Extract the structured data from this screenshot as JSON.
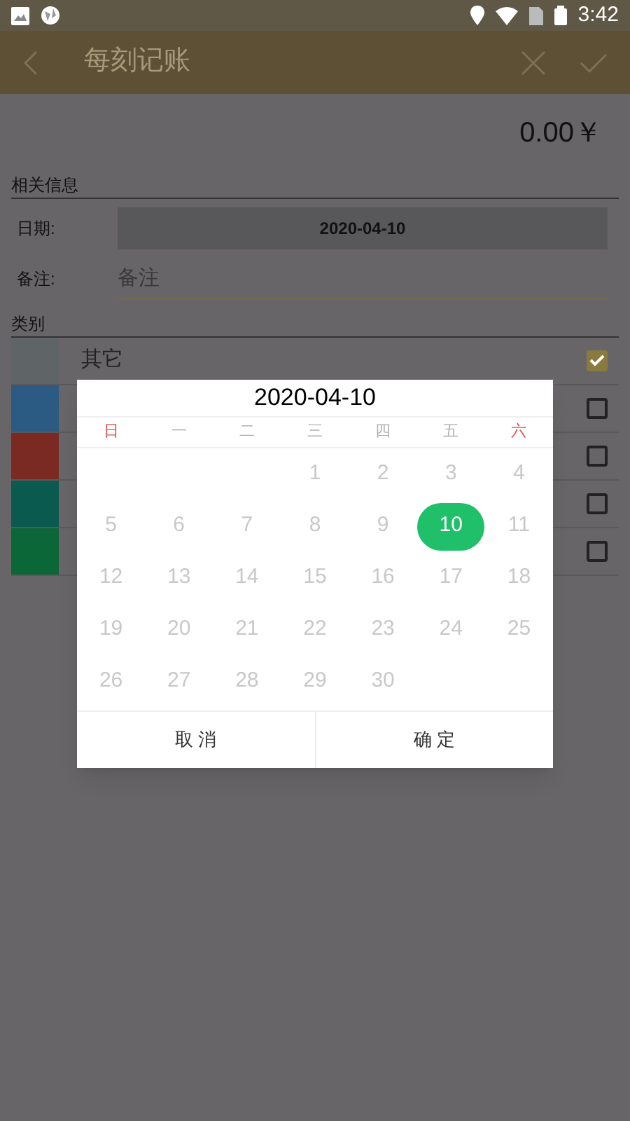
{
  "status_bar": {
    "time": "3:42"
  },
  "header": {
    "title": "每刻记账"
  },
  "amount": "0.00￥",
  "info_section": {
    "title": "相关信息",
    "date_label": "日期:",
    "date_value": "2020-04-10",
    "note_label": "备注:",
    "note_placeholder": "备注"
  },
  "category_section": {
    "title": "类别",
    "items": [
      {
        "name": "其它",
        "color": "#5f6466",
        "checked": true
      },
      {
        "color": "#2b5a82",
        "checked": false
      },
      {
        "color": "#7a2a22",
        "checked": false
      },
      {
        "color": "#0b5a50",
        "checked": false
      },
      {
        "color": "#0b6638",
        "checked": false
      }
    ]
  },
  "dialog": {
    "title": "2020-04-10",
    "weekdays": [
      {
        "label": "日",
        "color": "#d9534f"
      },
      {
        "label": "一",
        "color": "#b0b0b0"
      },
      {
        "label": "二",
        "color": "#b0b0b0"
      },
      {
        "label": "三",
        "color": "#b0b0b0"
      },
      {
        "label": "四",
        "color": "#b0b0b0"
      },
      {
        "label": "五",
        "color": "#b0b0b0"
      },
      {
        "label": "六",
        "color": "#d9534f"
      }
    ],
    "days": [
      {
        "label": "1",
        "selected": false
      },
      {
        "label": "2",
        "selected": false
      },
      {
        "label": "3",
        "selected": false
      },
      {
        "label": "4",
        "selected": false
      },
      {
        "label": "5",
        "selected": false
      },
      {
        "label": "6",
        "selected": false
      },
      {
        "label": "7",
        "selected": false
      },
      {
        "label": "8",
        "selected": false
      },
      {
        "label": "9",
        "selected": false
      },
      {
        "label": "10",
        "selected": true
      },
      {
        "label": "11",
        "selected": false
      },
      {
        "label": "12",
        "selected": false
      },
      {
        "label": "13",
        "selected": false
      },
      {
        "label": "14",
        "selected": false
      },
      {
        "label": "15",
        "selected": false
      },
      {
        "label": "16",
        "selected": false
      },
      {
        "label": "17",
        "selected": false
      },
      {
        "label": "18",
        "selected": false
      },
      {
        "label": "19",
        "selected": false
      },
      {
        "label": "20",
        "selected": false
      },
      {
        "label": "21",
        "selected": false
      },
      {
        "label": "22",
        "selected": false
      },
      {
        "label": "23",
        "selected": false
      },
      {
        "label": "24",
        "selected": false
      },
      {
        "label": "25",
        "selected": false
      },
      {
        "label": "26",
        "selected": false
      },
      {
        "label": "27",
        "selected": false
      },
      {
        "label": "28",
        "selected": false
      },
      {
        "label": "29",
        "selected": false
      },
      {
        "label": "30",
        "selected": false
      }
    ],
    "cancel": "取 消",
    "confirm": "确 定"
  }
}
